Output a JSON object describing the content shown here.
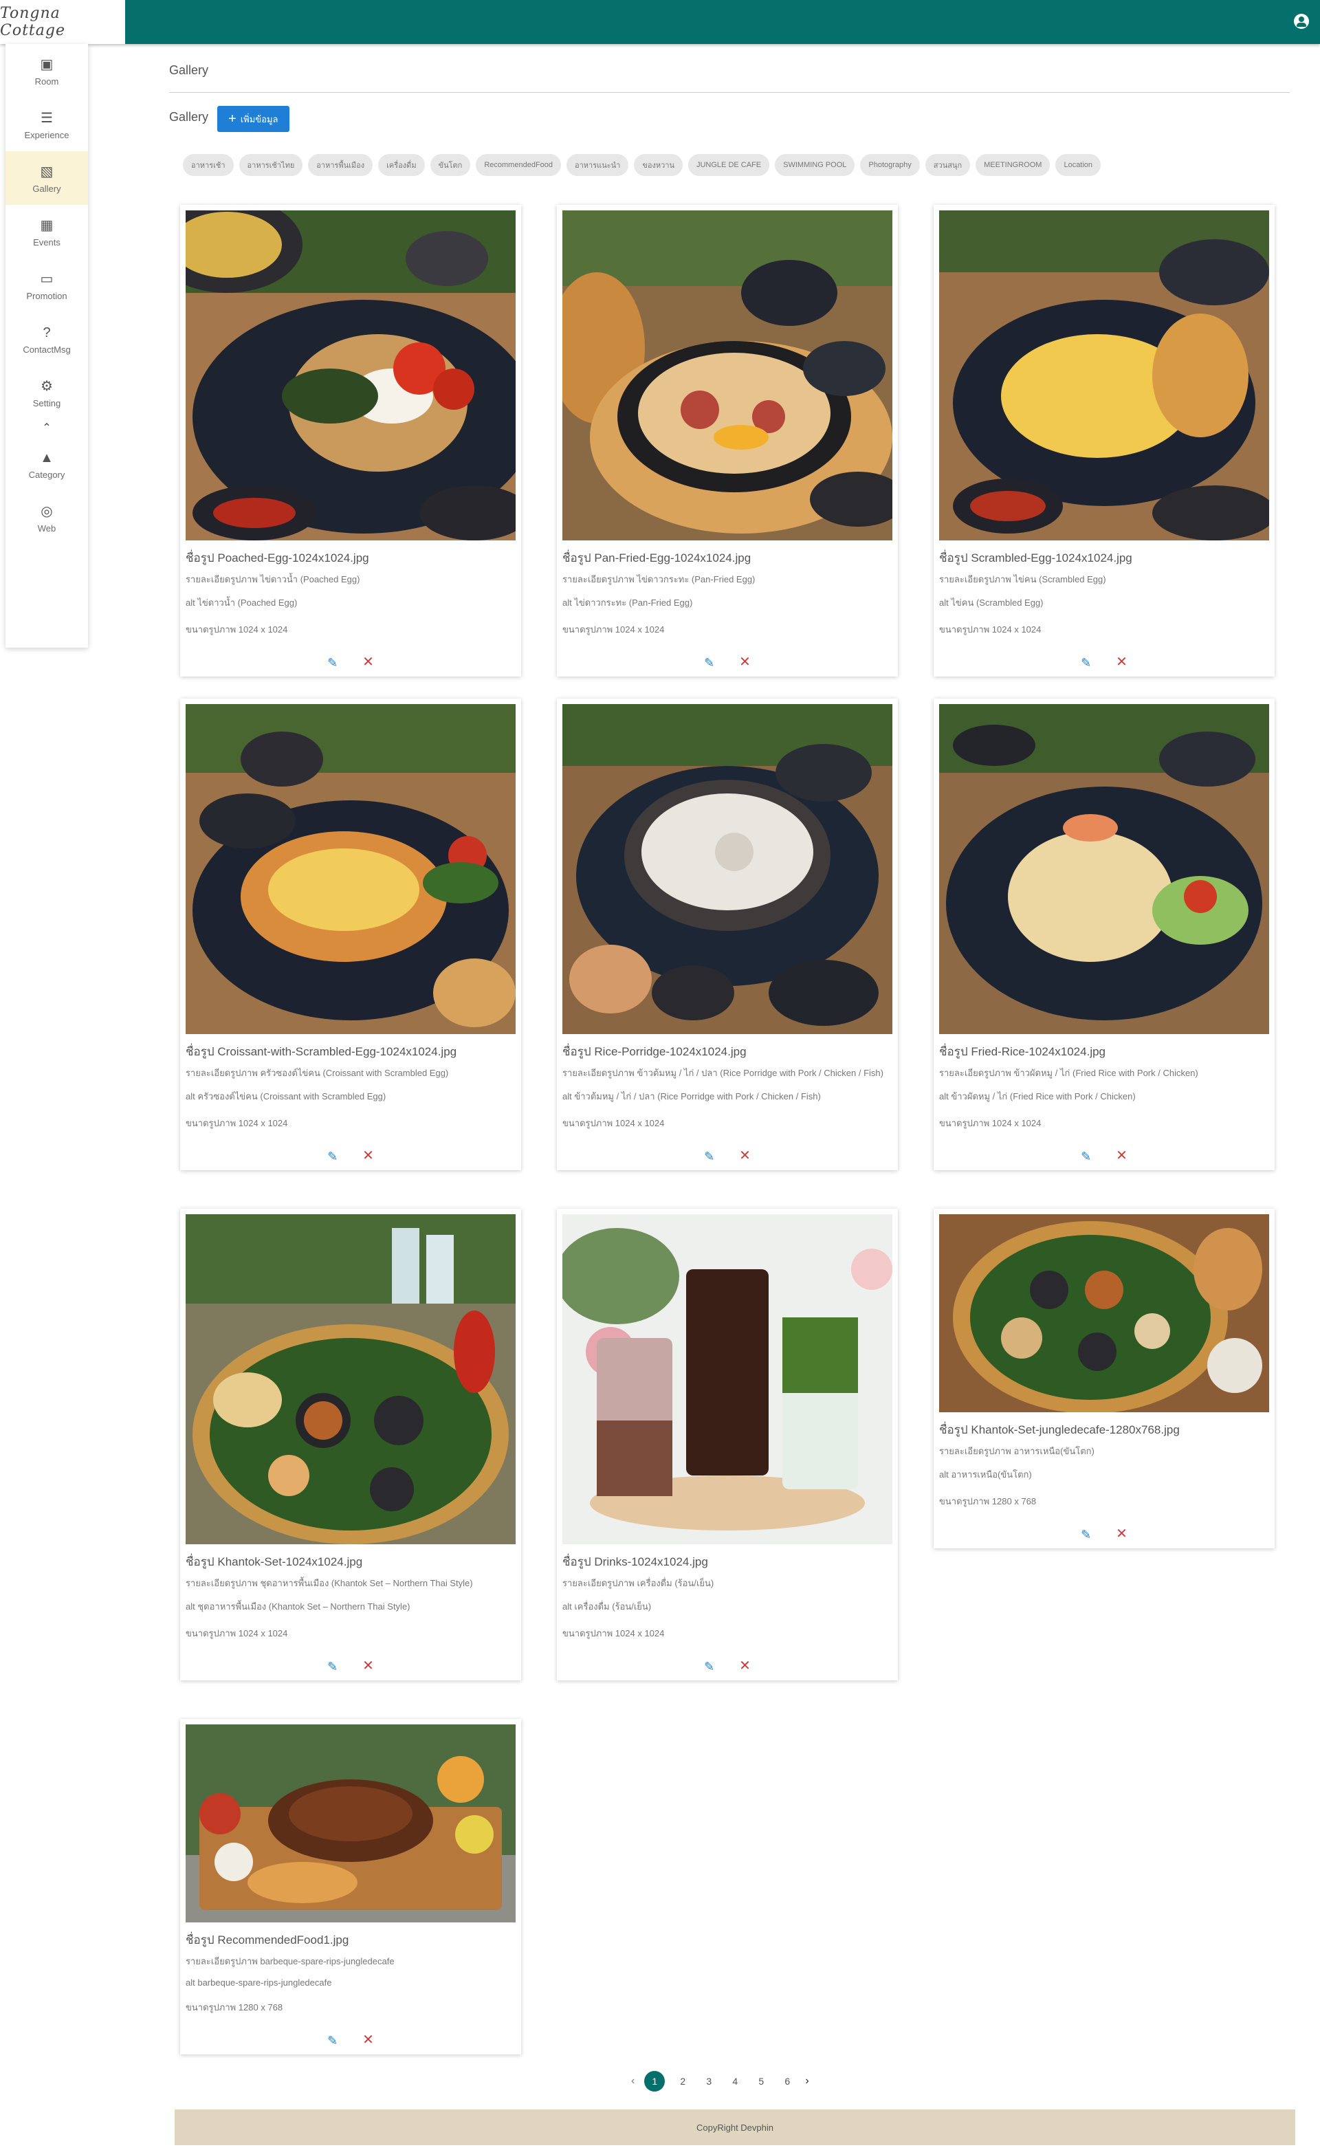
{
  "brand": {
    "logo_text": "Tongna Cottage"
  },
  "header": {
    "user_icon": "user-circle-icon",
    "accent_color": "#05706b"
  },
  "sidebar": {
    "items": [
      {
        "label": "Room",
        "icon": "room-icon",
        "glyph": "▣"
      },
      {
        "label": "Experience",
        "icon": "list-icon",
        "glyph": "☰"
      },
      {
        "label": "Gallery",
        "icon": "image-icon",
        "glyph": "▧",
        "active": true
      },
      {
        "label": "Events",
        "icon": "calendar-icon",
        "glyph": "▦"
      },
      {
        "label": "Promotion",
        "icon": "monitor-icon",
        "glyph": "▭"
      },
      {
        "label": "ContactMsg",
        "icon": "question-icon",
        "glyph": "?"
      },
      {
        "label": "Setting",
        "icon": "gear-icon",
        "glyph": "⚙"
      },
      {
        "label": "Category",
        "icon": "shapes-icon",
        "glyph": "▲"
      },
      {
        "label": "Web",
        "icon": "globe-icon",
        "glyph": "◎"
      }
    ],
    "collapse_icon": "chevron-up-icon"
  },
  "breadcrumb": "Gallery",
  "section": {
    "title": "Gallery",
    "add_button": "เพิ่มข้อมูล"
  },
  "categories": [
    "อาหารเช้า",
    "อาหารเช้าไทย",
    "อาหารพื้นเมือง",
    "เครื่องดื่ม",
    "ขันโตก",
    "RecommendedFood",
    "อาหารแนะนำ",
    "ของหวาน",
    "JUNGLE DE CAFE",
    "SWIMMING POOL",
    "Photography",
    "สวนสนุก",
    "MEETINGROOM",
    "Location"
  ],
  "cards": [
    {
      "name": "ชื่อรูป Poached-Egg-1024x1024.jpg",
      "desc": "รายละเอียดรูปภาพ ไข่ดาวน้ำ (Poached Egg)",
      "alt": "alt ไข่ดาวน้ำ (Poached Egg)",
      "size": "ขนาดรูปภาพ 1024 x 1024"
    },
    {
      "name": "ชื่อรูป Pan-Fried-Egg-1024x1024.jpg",
      "desc": "รายละเอียดรูปภาพ ไข่ดาวกระทะ (Pan-Fried Egg)",
      "alt": "alt ไข่ดาวกระทะ (Pan-Fried Egg)",
      "size": "ขนาดรูปภาพ 1024 x 1024"
    },
    {
      "name": "ชื่อรูป Scrambled-Egg-1024x1024.jpg",
      "desc": "รายละเอียดรูปภาพ ไข่คน (Scrambled Egg)",
      "alt": "alt ไข่คน (Scrambled Egg)",
      "size": "ขนาดรูปภาพ 1024 x 1024"
    },
    {
      "name": "ชื่อรูป Croissant-with-Scrambled-Egg-1024x1024.jpg",
      "desc": "รายละเอียดรูปภาพ ครัวซองต์ไข่คน (Croissant with Scrambled Egg)",
      "alt": "alt ครัวซองต์ไข่คน (Croissant with Scrambled Egg)",
      "size": "ขนาดรูปภาพ 1024 x 1024"
    },
    {
      "name": "ชื่อรูป Rice-Porridge-1024x1024.jpg",
      "desc": "รายละเอียดรูปภาพ ข้าวต้มหมู / ไก่ / ปลา (Rice Porridge with Pork / Chicken / Fish)",
      "alt": "alt ข้าวต้มหมู / ไก่ / ปลา (Rice Porridge with Pork / Chicken / Fish)",
      "size": "ขนาดรูปภาพ 1024 x 1024"
    },
    {
      "name": "ชื่อรูป Fried-Rice-1024x1024.jpg",
      "desc": "รายละเอียดรูปภาพ ข้าวผัดหมู / ไก่ (Fried Rice with Pork / Chicken)",
      "alt": "alt ข้าวผัดหมู / ไก่ (Fried Rice with Pork / Chicken)",
      "size": "ขนาดรูปภาพ 1024 x 1024"
    },
    {
      "name": "ชื่อรูป Khantok-Set-1024x1024.jpg",
      "desc": "รายละเอียดรูปภาพ ชุดอาหารพื้นเมือง (Khantok Set – Northern Thai Style)",
      "alt": "alt ชุดอาหารพื้นเมือง (Khantok Set – Northern Thai Style)",
      "size": "ขนาดรูปภาพ 1024 x 1024"
    },
    {
      "name": "ชื่อรูป Drinks-1024x1024.jpg",
      "desc": "รายละเอียดรูปภาพ เครื่องดื่ม (ร้อน/เย็น)",
      "alt": "alt เครื่องดื่ม (ร้อน/เย็น)",
      "size": "ขนาดรูปภาพ 1024 x 1024"
    },
    {
      "name": "ชื่อรูป Khantok-Set-jungledecafe-1280x768.jpg",
      "desc": "รายละเอียดรูปภาพ อาหารเหนือ(ขันโตก)",
      "alt": "alt อาหารเหนือ(ขันโตก)",
      "size": "ขนาดรูปภาพ 1280 x 768"
    },
    {
      "name": "ชื่อรูป RecommendedFood1.jpg",
      "desc": "รายละเอียดรูปภาพ barbeque-spare-rips-jungledecafe",
      "alt": "alt barbeque-spare-rips-jungledecafe",
      "size": "ขนาดรูปภาพ 1280 x 768"
    }
  ],
  "card_actions": {
    "edit_icon": "pencil-icon",
    "delete_icon": "close-icon"
  },
  "pagination": {
    "pages": [
      "1",
      "2",
      "3",
      "4",
      "5",
      "6"
    ],
    "current": "1",
    "prev": "‹",
    "next": "›"
  },
  "footer": {
    "text": "CopyRight Devphin"
  }
}
